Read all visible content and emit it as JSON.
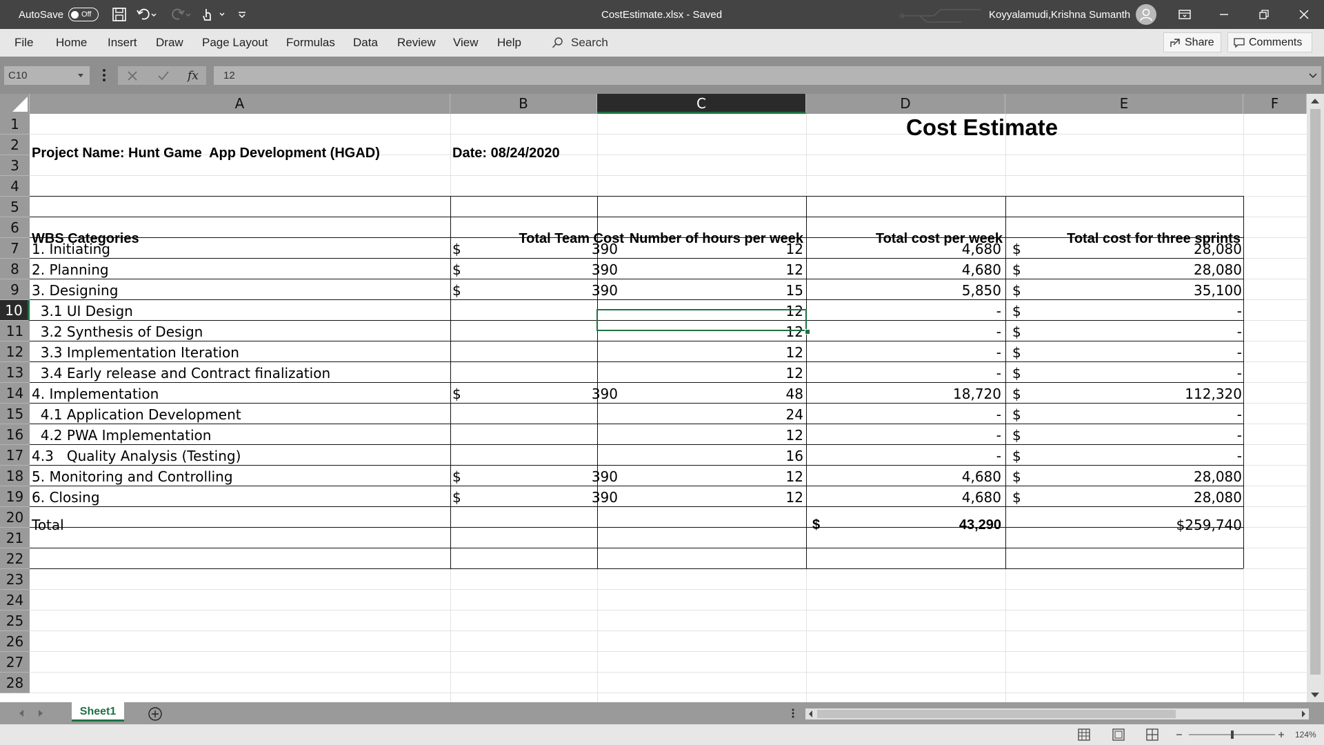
{
  "titlebar": {
    "autosave_label": "AutoSave",
    "autosave_state": "Off",
    "file_title": "CostEstimate.xlsx  -  Saved",
    "user_name": "Koyyalamudi,Krishna Sumanth"
  },
  "ribbon": {
    "tabs": [
      "File",
      "Home",
      "Insert",
      "Draw",
      "Page Layout",
      "Formulas",
      "Data",
      "Review",
      "View",
      "Help"
    ],
    "search_label": "Search",
    "share_label": "Share",
    "comments_label": "Comments"
  },
  "formula_bar": {
    "name_box": "C10",
    "fx_label": "fx",
    "formula": "12"
  },
  "columns": [
    "A",
    "B",
    "C",
    "D",
    "E",
    "F"
  ],
  "selected_column": "C",
  "selected_row": 10,
  "rows": [
    "1",
    "2",
    "3",
    "4",
    "5",
    "6",
    "7",
    "8",
    "9",
    "10",
    "11",
    "12",
    "13",
    "14",
    "15",
    "16",
    "17",
    "18",
    "19",
    "20",
    "21",
    "22",
    "23",
    "24",
    "25",
    "26",
    "27",
    "28"
  ],
  "sheet": {
    "title": "Cost Estimate",
    "project": "Project Name: Hunt Game  App Development (HGAD)",
    "date": "Date: 08/24/2020",
    "headers": [
      "WBS Categories",
      "Total Team Cost",
      "Number of hours per week",
      "Total cost per week",
      "Total cost for three sprints"
    ],
    "table": [
      {
        "a": "1. Initiating",
        "b_sym": "$",
        "b": "390",
        "c": "12",
        "d": "4,680",
        "e_sym": "$",
        "e": "28,080"
      },
      {
        "a": "2. Planning",
        "b_sym": "$",
        "b": "390",
        "c": "12",
        "d": "4,680",
        "e_sym": "$",
        "e": "28,080"
      },
      {
        "a": "3. Designing",
        "b_sym": "$",
        "b": "390",
        "c": "15",
        "d": "5,850",
        "e_sym": "$",
        "e": "35,100"
      },
      {
        "a": "  3.1 UI Design",
        "b_sym": "",
        "b": "",
        "c": "12",
        "d": "-",
        "e_sym": "$",
        "e": "-"
      },
      {
        "a": "  3.2 Synthesis of Design",
        "b_sym": "",
        "b": "",
        "c": "12",
        "d": "-",
        "e_sym": "$",
        "e": "-"
      },
      {
        "a": "  3.3 Implementation Iteration",
        "b_sym": "",
        "b": "",
        "c": "12",
        "d": "-",
        "e_sym": "$",
        "e": "-"
      },
      {
        "a": "  3.4 Early release and Contract finalization",
        "b_sym": "",
        "b": "",
        "c": "12",
        "d": "-",
        "e_sym": "$",
        "e": "-"
      },
      {
        "a": "4. Implementation",
        "b_sym": "$",
        "b": "390",
        "c": "48",
        "d": "18,720",
        "e_sym": "$",
        "e": "112,320"
      },
      {
        "a": "  4.1 Application Development",
        "b_sym": "",
        "b": "",
        "c": "24",
        "d": "-",
        "e_sym": "$",
        "e": "-"
      },
      {
        "a": "  4.2 PWA Implementation",
        "b_sym": "",
        "b": "",
        "c": "12",
        "d": "-",
        "e_sym": "$",
        "e": "-"
      },
      {
        "a": "4.3   Quality Analysis (Testing)",
        "b_sym": "",
        "b": "",
        "c": "16",
        "d": "-",
        "e_sym": "$",
        "e": "-"
      },
      {
        "a": "5. Monitoring and Controlling",
        "b_sym": "$",
        "b": "390",
        "c": "12",
        "d": "4,680",
        "e_sym": "$",
        "e": "28,080"
      },
      {
        "a": "6. Closing",
        "b_sym": "$",
        "b": "390",
        "c": "12",
        "d": "4,680",
        "e_sym": "$",
        "e": "28,080"
      }
    ],
    "total_label": "Total",
    "total_d_sym": "$",
    "total_d": "43,290",
    "total_e": "$259,740"
  },
  "sheet_tabs": [
    "Sheet1"
  ],
  "status": {
    "zoom": "124%"
  },
  "colors": {
    "accent": "#1e7145",
    "titlebar": "#444444"
  }
}
